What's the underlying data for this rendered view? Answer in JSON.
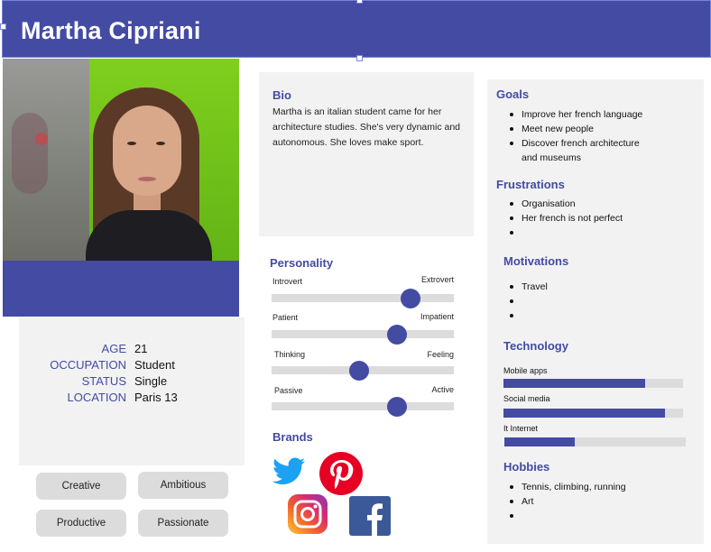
{
  "persona": {
    "name": "Martha Cipriani"
  },
  "info": [
    {
      "label": "AGE",
      "value": "21"
    },
    {
      "label": "OCCUPATION",
      "value": "Student"
    },
    {
      "label": "STATUS",
      "value": "Single"
    },
    {
      "label": "LOCATION",
      "value": "Paris 13"
    }
  ],
  "traits": [
    "Creative",
    "Ambitious",
    "Productive",
    "Passionate"
  ],
  "bio": {
    "title": "Bio",
    "text": "Martha is an italian student came for her architecture studies.  She's very dynamic and autonomous. She loves make sport."
  },
  "personality": {
    "title": "Personality",
    "sliders": [
      {
        "left": "Introvert",
        "right": "Extrovert",
        "value": 0.76
      },
      {
        "left": "Patient",
        "right": "Impatient",
        "value": 0.69
      },
      {
        "left": "Thinking",
        "right": "Feeling",
        "value": 0.48
      },
      {
        "left": "Passive",
        "right": "Active",
        "value": 0.69
      }
    ]
  },
  "brands": {
    "title": "Brands",
    "items": [
      "twitter-icon",
      "pinterest-icon",
      "instagram-icon",
      "facebook-icon"
    ]
  },
  "goals": {
    "title": "Goals",
    "items": [
      "Improve her french language",
      "Meet new people",
      "Discover french architecture and museums"
    ]
  },
  "frustrations": {
    "title": "Frustrations",
    "items": [
      "Organisation",
      "Her french is not perfect",
      ""
    ]
  },
  "motivations": {
    "title": "Motivations",
    "items": [
      "Travel",
      "",
      ""
    ]
  },
  "technology": {
    "title": "Technology",
    "items": [
      {
        "label": "Mobile apps",
        "value": 0.79
      },
      {
        "label": "Social media",
        "value": 0.9
      },
      {
        "label": "It Internet",
        "value": 0.39
      }
    ]
  },
  "hobbies": {
    "title": "Hobbies",
    "items": [
      "Tennis, climbing, running",
      "Art",
      ""
    ]
  },
  "colors": {
    "accent": "#434ba3",
    "panel": "#f2f2f2",
    "track": "#dcdcdc"
  }
}
